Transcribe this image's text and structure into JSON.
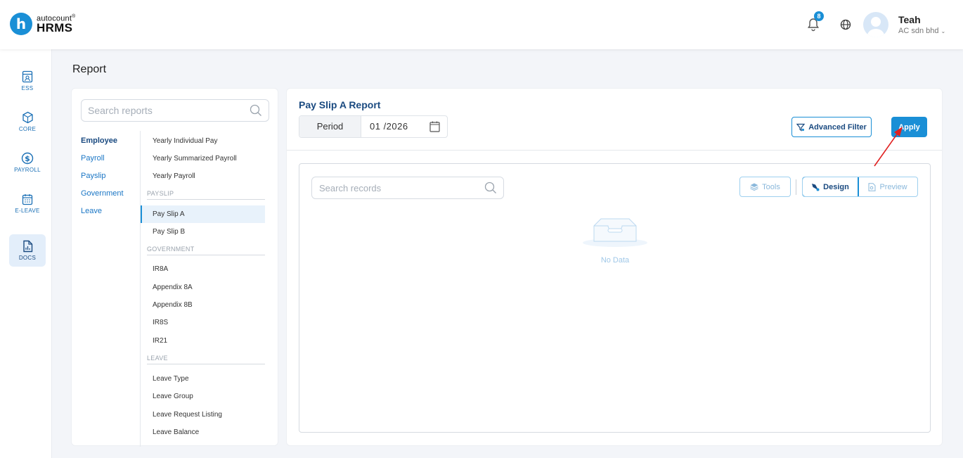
{
  "header": {
    "logo_small": "autocount",
    "logo_reg": "®",
    "logo_big": "HRMS",
    "logo_letter": "h",
    "notification_count": "8",
    "user_name": "Teah",
    "user_company": "AC sdn bhd",
    "icons": [
      "bell-icon",
      "globe-icon",
      "avatar"
    ]
  },
  "rail": {
    "items": [
      {
        "label": "ESS",
        "icon": "ess-icon"
      },
      {
        "label": "CORE",
        "icon": "core-icon"
      },
      {
        "label": "PAYROLL",
        "icon": "payroll-icon"
      },
      {
        "label": "E-LEAVE",
        "icon": "calendar-icon"
      },
      {
        "label": "DOCS",
        "icon": "docs-icon",
        "active": true
      }
    ]
  },
  "page": {
    "title": "Report"
  },
  "reports_panel": {
    "search_placeholder": "Search reports",
    "categories": [
      "Employee",
      "Payroll",
      "Payslip",
      "Government",
      "Leave"
    ],
    "active_category": "Employee",
    "items": [
      {
        "label": "Yearly Individual Pay"
      },
      {
        "label": "Yearly Summarized Payroll"
      },
      {
        "label": "Yearly Payroll"
      }
    ],
    "sections": [
      {
        "title": "PAYSLIP",
        "items": [
          "Pay Slip A",
          "Pay Slip B"
        ]
      },
      {
        "title": "GOVERNMENT",
        "items": [
          "IR8A",
          "Appendix 8A",
          "Appendix 8B",
          "IR8S",
          "IR21"
        ]
      },
      {
        "title": "LEAVE",
        "items": [
          "Leave Type",
          "Leave Group",
          "Leave Request Listing",
          "Leave Balance"
        ]
      }
    ],
    "active_item": "Pay Slip A"
  },
  "main": {
    "report_title": "Pay Slip A Report",
    "period_label": "Period",
    "period_value": "01 /2026",
    "advanced_filter_label": "Advanced Filter",
    "apply_label": "Apply",
    "search_records_placeholder": "Search records",
    "tools_label": "Tools",
    "design_label": "Design",
    "preview_label": "Preview",
    "empty_text": "No Data"
  },
  "colors": {
    "primary": "#1a8fd6",
    "title": "#1a4a80",
    "annotation_arrow": "#e02020"
  }
}
